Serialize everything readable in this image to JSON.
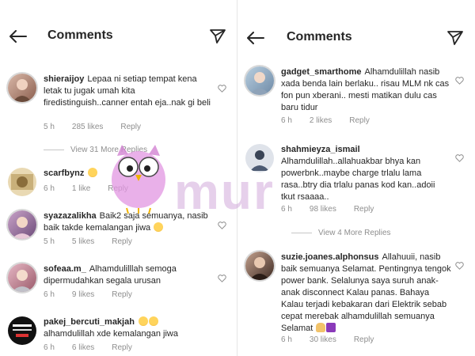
{
  "left": {
    "title": "Comments",
    "comments": [
      {
        "user": "shieraijoy",
        "text": "Lepaa ni setiap tempat kena letak tu jugak umah kita firedistinguish..canner entah eja..nak gi beli",
        "time": "5 h",
        "likes": "285 likes",
        "reply": "Reply"
      },
      {
        "user": "scarfbynz",
        "text": "",
        "time": "6 h",
        "likes": "1 like",
        "reply": "Reply"
      },
      {
        "user": "syazazalikha",
        "text": "Baik2 saja semuanya, nasib baik takde kemalangan jiwa",
        "time": "5 h",
        "likes": "5 likes",
        "reply": "Reply"
      },
      {
        "user": "sofeaa.m_",
        "text": "Alhamdulilllah semoga dipermudahkan segala urusan",
        "time": "6 h",
        "likes": "9 likes",
        "reply": "Reply"
      },
      {
        "user": "pakej_bercuti_makjah",
        "text": "alhamdulillah xde kemalangan jiwa",
        "time": "6 h",
        "likes": "6 likes",
        "reply": "Reply"
      }
    ],
    "view_more": "View 31 More Replies"
  },
  "right": {
    "title": "Comments",
    "comments": [
      {
        "user": "gadget_smarthome",
        "text": "Alhamdulillah nasib xada benda lain berlaku.. risau MLM nk cas fon pun xberani.. mesti matikan dulu cas baru tidur",
        "time": "6 h",
        "likes": "2 likes",
        "reply": "Reply"
      },
      {
        "user": "shahmieyza_ismail",
        "text": "Alhamdulillah..allahuakbar bhya kan powerbnk..maybe charge trlalu lama rasa..btry dia trlalu panas kod kan..adoii tkut rsaaaa..",
        "time": "6 h",
        "likes": "98 likes",
        "reply": "Reply"
      },
      {
        "user": "suzie.joanes.alphonsus",
        "text": "Allahuuii, nasib baik semuanya Selamat. Pentingnya tengok power bank. Selalunya saya suruh anak-anak disconnect Kalau panas. Bahaya Kalau terjadi kebakaran dari Elektrik sebab cepat merebak alhamdulillah semuanya Selamat",
        "time": "6 h",
        "likes": "30 likes",
        "reply": "Reply"
      }
    ],
    "view_more": "View 4 More Replies"
  },
  "watermark": "mur"
}
